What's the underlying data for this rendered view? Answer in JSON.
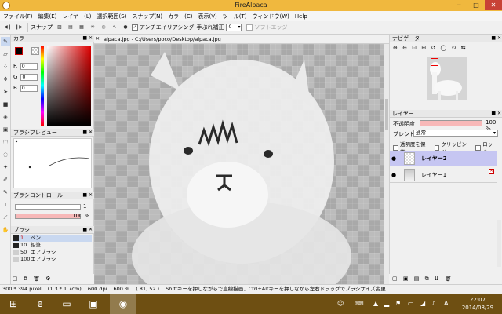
{
  "window": {
    "title": "FireAlpaca",
    "min": "─",
    "max": "□",
    "close": "✕"
  },
  "menu": [
    "ファイル(F)",
    "編集(E)",
    "レイヤー(L)",
    "選択範囲(S)",
    "スナップ(N)",
    "カラー(C)",
    "表示(V)",
    "ツール(T)",
    "ウィンドウ(W)",
    "Help"
  ],
  "toolbar": {
    "snap_label": "スナップ",
    "antialias_label": "アンチエイリアシング",
    "antialias_checked": "✓",
    "stabilizer_label": "手ぶれ補正",
    "stabilizer_value": "0",
    "soft_edge_label": "ソフトエッジ"
  },
  "panels": {
    "color": {
      "title": "カラー",
      "r_label": "R",
      "r_value": "0",
      "g_label": "G",
      "g_value": "0",
      "b_label": "B",
      "b_value": "0"
    },
    "brush_preview": {
      "title": "ブラシプレビュー"
    },
    "brush_control": {
      "title": "ブラシコントロール",
      "size_value": "1",
      "opacity_value": "100 %"
    },
    "brush": {
      "title": "ブラシ",
      "items": [
        {
          "num": "1",
          "name": "ペン",
          "color": "#222222"
        },
        {
          "num": "10",
          "name": "鉛筆",
          "color": "#222222"
        },
        {
          "num": "50",
          "name": "エアブラシ",
          "color": "#cfcfcf"
        },
        {
          "num": "100",
          "name": "エアブラシ",
          "color": "#cfcfcf"
        }
      ]
    },
    "navigator": {
      "title": "ナビゲーター"
    },
    "layer": {
      "title": "レイヤー",
      "opacity_label": "不透明度",
      "opacity_value": "100 %",
      "blend_label": "ブレンド",
      "blend_value": "通常",
      "protect_alpha": "透明度を保護",
      "clipping": "クリッピング",
      "lock": "ロック",
      "layers": [
        {
          "name": "レイヤー2"
        },
        {
          "name": "レイヤー1"
        }
      ]
    }
  },
  "canvas": {
    "tab_title": "alpaca.jpg - C:/Users/poco/Desktop/alpaca.jpg"
  },
  "status": {
    "size": "300 * 394 pixel",
    "physical": "(1.3 * 1.7cm)",
    "dpi": "600 dpi",
    "zoom": "600 %",
    "coords": "( 81, 52 )",
    "hint": "Shiftキーを押しながらで直線描画、Ctrl+Altキーを押しながら左右ドラッグでブラシサイズ変更"
  },
  "taskbar": {
    "time": "22:07",
    "date": "2014/08/29",
    "ime": "A"
  }
}
